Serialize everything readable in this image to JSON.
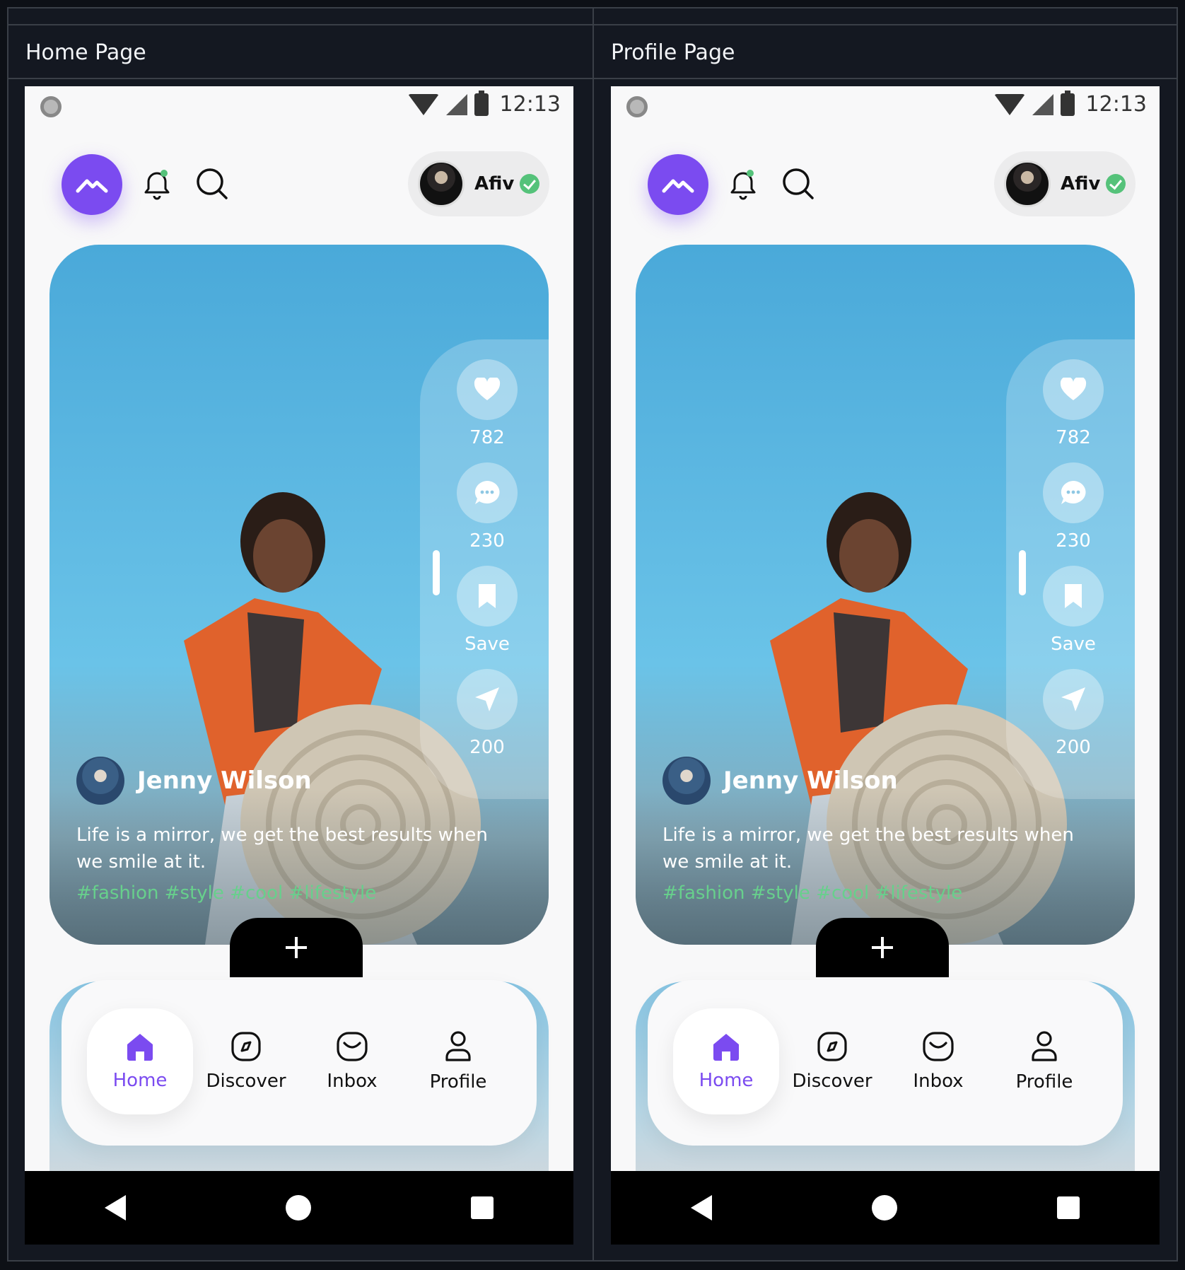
{
  "headers": {
    "left": "Home Page",
    "right": "Profile Page"
  },
  "status": {
    "time": "12:13"
  },
  "profile": {
    "name": "Afiv"
  },
  "post": {
    "author": "Jenny Wilson",
    "caption": "Life is a mirror, we get the best results when we smile at it.",
    "hashtags": "#fashion #style #cool #lifestyle",
    "likes": "782",
    "comments": "230",
    "save_label": "Save",
    "shares": "200"
  },
  "nav": {
    "items": [
      {
        "label": "Home",
        "icon": "home-icon",
        "active": true
      },
      {
        "label": "Discover",
        "icon": "compass-icon",
        "active": false
      },
      {
        "label": "Inbox",
        "icon": "inbox-icon",
        "active": false
      },
      {
        "label": "Profile",
        "icon": "user-icon",
        "active": false
      }
    ]
  },
  "colors": {
    "accent": "#7b4bf0",
    "verified": "#55c27a",
    "hashtag": "#67d08c",
    "frame_bg": "#141821"
  }
}
